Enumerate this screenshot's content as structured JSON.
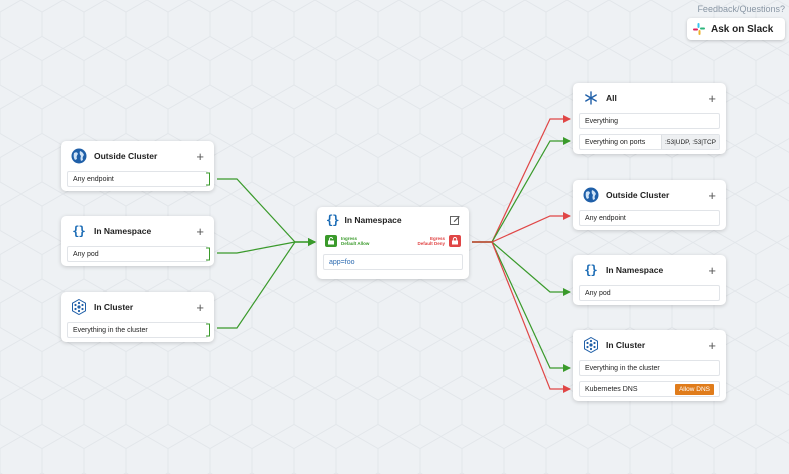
{
  "header": {
    "feedback_label": "Feedback/Questions?",
    "slack_button_label": "Ask on Slack"
  },
  "colors": {
    "allow_edge": "#3a9a2b",
    "deny_edge": "#e04646",
    "namespace_brace": "#1a6bb5",
    "dns_badge": "#e07c1b"
  },
  "ingress_sources": [
    {
      "icon": "globe-icon",
      "title": "Outside Cluster",
      "rows": [
        {
          "text": "Any endpoint"
        }
      ]
    },
    {
      "icon": "namespace-braces-icon",
      "title": "In Namespace",
      "rows": [
        {
          "text": "Any pod"
        }
      ]
    },
    {
      "icon": "cluster-icon",
      "title": "In Cluster",
      "rows": [
        {
          "text": "Everything in the cluster"
        }
      ]
    }
  ],
  "center": {
    "title": "In Namespace",
    "icon": "namespace-braces-icon",
    "edit_icon": "edit-icon",
    "ingress": {
      "line1": "Ingress",
      "line2": "Default Allow"
    },
    "egress": {
      "line1": "Egress",
      "line2": "Default Deny"
    },
    "selector": "app=foo"
  },
  "egress_targets": [
    {
      "icon": "asterisk-icon",
      "title": "All",
      "rows": [
        {
          "text": "Everything"
        },
        {
          "text": "Everything on ports",
          "tag": ":53|UDP, :53|TCP"
        }
      ]
    },
    {
      "icon": "globe-icon",
      "title": "Outside Cluster",
      "rows": [
        {
          "text": "Any endpoint"
        }
      ]
    },
    {
      "icon": "namespace-braces-icon",
      "title": "In Namespace",
      "rows": [
        {
          "text": "Any pod"
        }
      ]
    },
    {
      "icon": "cluster-icon",
      "title": "In Cluster",
      "rows": [
        {
          "text": "Everything in the cluster"
        },
        {
          "text": "Kubernetes DNS",
          "badge": "Allow DNS"
        }
      ]
    }
  ],
  "brace_glyph": "{}",
  "plus_glyph": "+"
}
